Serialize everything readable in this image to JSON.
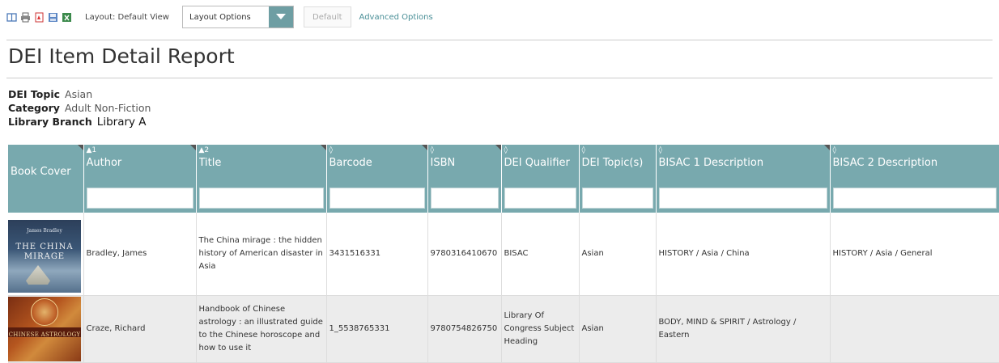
{
  "toolbar": {
    "icons": [
      "columns-icon",
      "print-icon",
      "pdf-icon",
      "save-icon",
      "excel-icon"
    ],
    "layout_label": "Layout: Default View",
    "layout_select_value": "Layout Options",
    "default_button": "Default",
    "advanced_link": "Advanced Options"
  },
  "page": {
    "title": "DEI Item Detail Report"
  },
  "filters": [
    {
      "label": "DEI Topic",
      "value": "Asian"
    },
    {
      "label": "Category",
      "value": "Adult Non-Fiction"
    },
    {
      "label": "Library Branch",
      "value": "Library A"
    }
  ],
  "table": {
    "columns": [
      {
        "label": "Book Cover",
        "sort": ""
      },
      {
        "label": "Author",
        "sort": "▲1"
      },
      {
        "label": "Title",
        "sort": "▲2"
      },
      {
        "label": "Barcode",
        "sort": "◊"
      },
      {
        "label": "ISBN",
        "sort": "◊"
      },
      {
        "label": "DEI Qualifier",
        "sort": "◊"
      },
      {
        "label": "DEI Topic(s)",
        "sort": "◊"
      },
      {
        "label": "BISAC 1 Description",
        "sort": "◊"
      },
      {
        "label": "BISAC 2 Description",
        "sort": "◊"
      }
    ],
    "rows": [
      {
        "cover": {
          "small_text": "James Bradley",
          "title_text": "THE CHINA MIRAGE"
        },
        "author": "Bradley, James",
        "title": "The China mirage : the hidden history of American disaster in Asia",
        "barcode": "3431516331",
        "isbn": "9780316410670",
        "qualifier": "BISAC",
        "topics": "Asian",
        "bisac1": "HISTORY / Asia / China",
        "bisac2": "HISTORY / Asia / General"
      },
      {
        "cover": {
          "title_text": "CHINESE ASTROLOGY"
        },
        "author": "Craze, Richard",
        "title": "Handbook of Chinese astrology : an illustrated guide to the Chinese horoscope and how to use it",
        "barcode": "1_5538765331",
        "isbn": "9780754826750",
        "qualifier": "Library Of Congress Subject Heading",
        "topics": "Asian",
        "bisac1": "BODY, MIND & SPIRIT / Astrology / Eastern",
        "bisac2": ""
      }
    ]
  },
  "colors": {
    "header_bg": "#78a9ae",
    "link": "#4a9ba3",
    "select_arrow_bg": "#6e9ea3"
  }
}
